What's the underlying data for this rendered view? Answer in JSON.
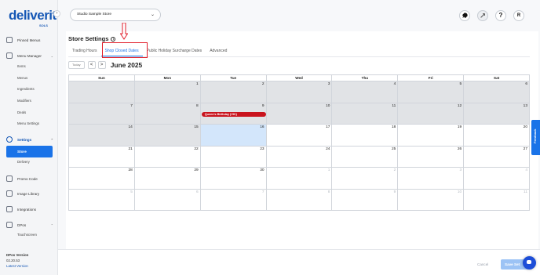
{
  "brand": {
    "logo": "deliverit",
    "logo_sub": "SOLS"
  },
  "sidebar": {
    "pinned_menus": "Pinned Menus",
    "menu_manager": "Menu Manager",
    "menu_sub": [
      "Items",
      "Menus",
      "Ingredients",
      "Modifiers",
      "Deals",
      "Menu Settings"
    ],
    "settings": "Settings",
    "store": "Store",
    "delivery": "Delivery",
    "promo_code": "Promo Code",
    "image_library": "Image Library",
    "integrations": "Integrations",
    "dpos": "DPos",
    "touchscreen": "Touchscreen",
    "version_label": "DPos Version",
    "version_number": "02.20.53",
    "latest_version": "Latest Version"
  },
  "header": {
    "store_select": "Studio Sample Store",
    "avatar_initial": "R",
    "help_icon": "?"
  },
  "page": {
    "title": "Store Settings",
    "tabs": [
      "Trading Hours",
      "Shop Closed Dates",
      "Public Holiday Surcharge Dates",
      "Advanced"
    ],
    "active_tab": 1
  },
  "calendar": {
    "today_label": "Today",
    "prev": "<",
    "next": ">",
    "title": "June 2025",
    "weekdays": [
      "Sun",
      "Mon",
      "Tue",
      "Wed",
      "Thu",
      "Fri",
      "Sat"
    ],
    "weeks": [
      [
        {
          "d": "",
          "s": "past"
        },
        {
          "d": "1",
          "s": "past"
        },
        {
          "d": "2",
          "s": "past"
        },
        {
          "d": "3",
          "s": "past"
        },
        {
          "d": "4",
          "s": "past"
        },
        {
          "d": "5",
          "s": "past"
        },
        {
          "d": "6",
          "s": "past"
        }
      ],
      [
        {
          "d": "7",
          "s": "past"
        },
        {
          "d": "8",
          "s": "past"
        },
        {
          "d": "9",
          "s": "past"
        },
        {
          "d": "10",
          "s": "past"
        },
        {
          "d": "11",
          "s": "past"
        },
        {
          "d": "12",
          "s": "past"
        },
        {
          "d": "13",
          "s": "past"
        }
      ],
      [
        {
          "d": "14",
          "s": "past"
        },
        {
          "d": "15",
          "s": "past"
        },
        {
          "d": "16",
          "s": "today"
        },
        {
          "d": "17",
          "s": ""
        },
        {
          "d": "18",
          "s": ""
        },
        {
          "d": "19",
          "s": ""
        },
        {
          "d": "20",
          "s": ""
        }
      ],
      [
        {
          "d": "21",
          "s": ""
        },
        {
          "d": "22",
          "s": ""
        },
        {
          "d": "23",
          "s": ""
        },
        {
          "d": "24",
          "s": ""
        },
        {
          "d": "25",
          "s": ""
        },
        {
          "d": "26",
          "s": ""
        },
        {
          "d": "27",
          "s": ""
        }
      ],
      [
        {
          "d": "28",
          "s": ""
        },
        {
          "d": "29",
          "s": ""
        },
        {
          "d": "30",
          "s": ""
        },
        {
          "d": "1",
          "s": "other"
        },
        {
          "d": "2",
          "s": "other"
        },
        {
          "d": "3",
          "s": "other"
        },
        {
          "d": "4",
          "s": "other"
        }
      ],
      [
        {
          "d": "5",
          "s": "other"
        },
        {
          "d": "6",
          "s": "other"
        },
        {
          "d": "7",
          "s": "other"
        },
        {
          "d": "8",
          "s": "other"
        },
        {
          "d": "9",
          "s": "other"
        },
        {
          "d": "10",
          "s": "other"
        },
        {
          "d": "11",
          "s": "other"
        }
      ]
    ],
    "event": {
      "label": "Queen's Birthday (VIC)",
      "date": "9"
    }
  },
  "footer": {
    "cancel": "Cancel",
    "save": "Save Set"
  },
  "feedback": "Feedback",
  "colors": {
    "primary": "#1a73e8",
    "event": "#c9141e",
    "highlight": "#e11d2a"
  }
}
